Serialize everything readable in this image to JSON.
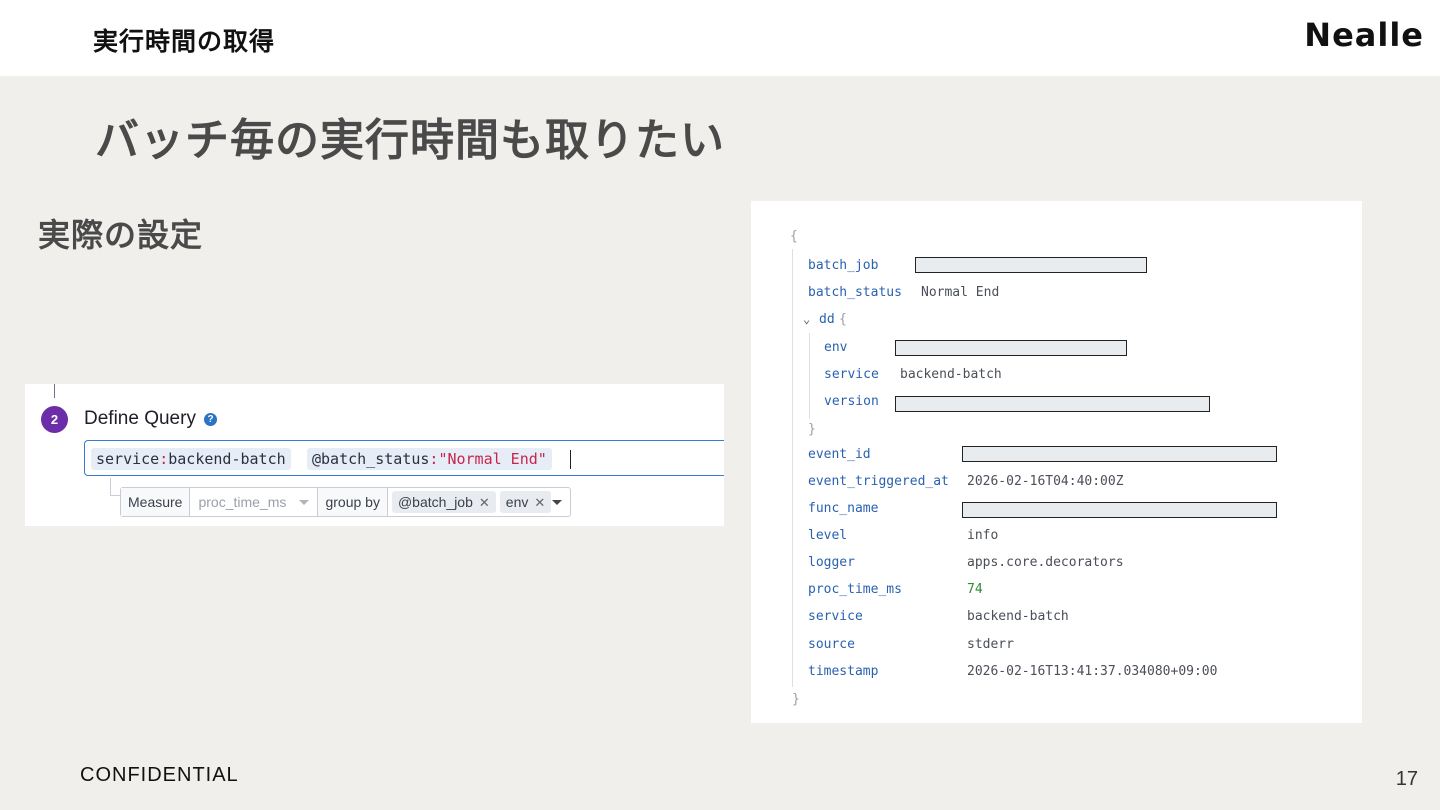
{
  "header": {
    "section_title": "実行時間の取得",
    "brand": "Nealle"
  },
  "slide": {
    "title": "バッチ毎の実行時間も取りたい",
    "subtitle": "実際の設定"
  },
  "query_editor": {
    "step_number": "2",
    "step_title": "Define Query",
    "help_icon": "?",
    "tokens": [
      {
        "key": "service",
        "colon": ":",
        "value": "backend-batch"
      },
      {
        "key": "@batch_status",
        "colon": ":",
        "value": "\"Normal End\""
      }
    ],
    "measure_label": "Measure",
    "measure_placeholder": "proc_time_ms",
    "group_by_label": "group by",
    "group_by_tags": [
      "@batch_job",
      "env"
    ],
    "tag_remove_glyph": "✕"
  },
  "json_view": {
    "open_brace": "{",
    "close_brace": "}",
    "fields": {
      "batch_job": {
        "key": "batch_job",
        "redacted": true
      },
      "batch_status": {
        "key": "batch_status",
        "value": "Normal End"
      },
      "dd": {
        "key": "dd",
        "open": "{",
        "close": "}"
      },
      "env": {
        "key": "env",
        "redacted": true
      },
      "service_dd": {
        "key": "service",
        "value": "backend-batch"
      },
      "version": {
        "key": "version",
        "redacted": true
      },
      "event_id": {
        "key": "event_id",
        "redacted": true
      },
      "event_triggered_at": {
        "key": "event_triggered_at",
        "value": "2026-02-16T04:40:00Z"
      },
      "func_name": {
        "key": "func_name",
        "redacted": true
      },
      "level": {
        "key": "level",
        "value": "info"
      },
      "logger": {
        "key": "logger",
        "value": "apps.core.decorators"
      },
      "proc_time_ms": {
        "key": "proc_time_ms",
        "value": "74"
      },
      "service": {
        "key": "service",
        "value": "backend-batch"
      },
      "source": {
        "key": "source",
        "value": "stderr"
      },
      "timestamp": {
        "key": "timestamp",
        "value": "2026-02-16T13:41:37.034080+09:00"
      }
    },
    "expand_icon": "chevron-down-icon",
    "key_color": "#2a62b0",
    "number_color": "#2e8b3a"
  },
  "footer": {
    "confidential": "CONFIDENTIAL",
    "page_number": "17"
  }
}
